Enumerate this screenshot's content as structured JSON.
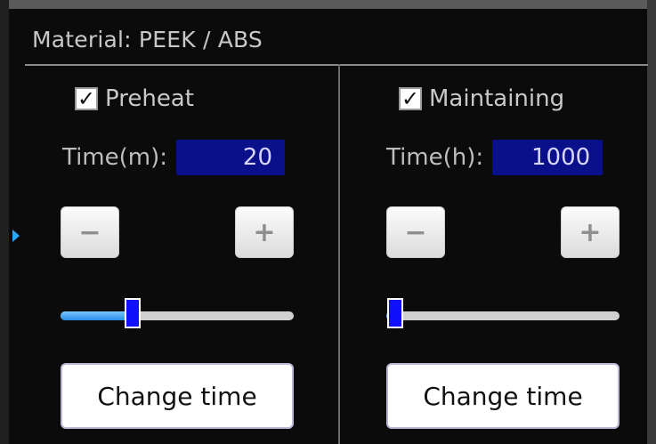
{
  "header": {
    "title": "Material: PEEK / ABS"
  },
  "preheat": {
    "checkbox_mark": "✓",
    "label": "Preheat",
    "time_label": "Time(m):",
    "time_value": "20",
    "minus_label": "−",
    "plus_label": "+",
    "slider_fraction": 0.31,
    "change_button": "Change time"
  },
  "maintaining": {
    "checkbox_mark": "✓",
    "label": "Maintaining",
    "time_label": "Time(h):",
    "time_value": "1000",
    "minus_label": "−",
    "plus_label": "+",
    "slider_fraction": 0.04,
    "change_button": "Change time"
  },
  "colors": {
    "value_box_bg": "#0a0f8a",
    "slider_thumb": "#1010ff",
    "slider_fill": "#2a8de8"
  }
}
